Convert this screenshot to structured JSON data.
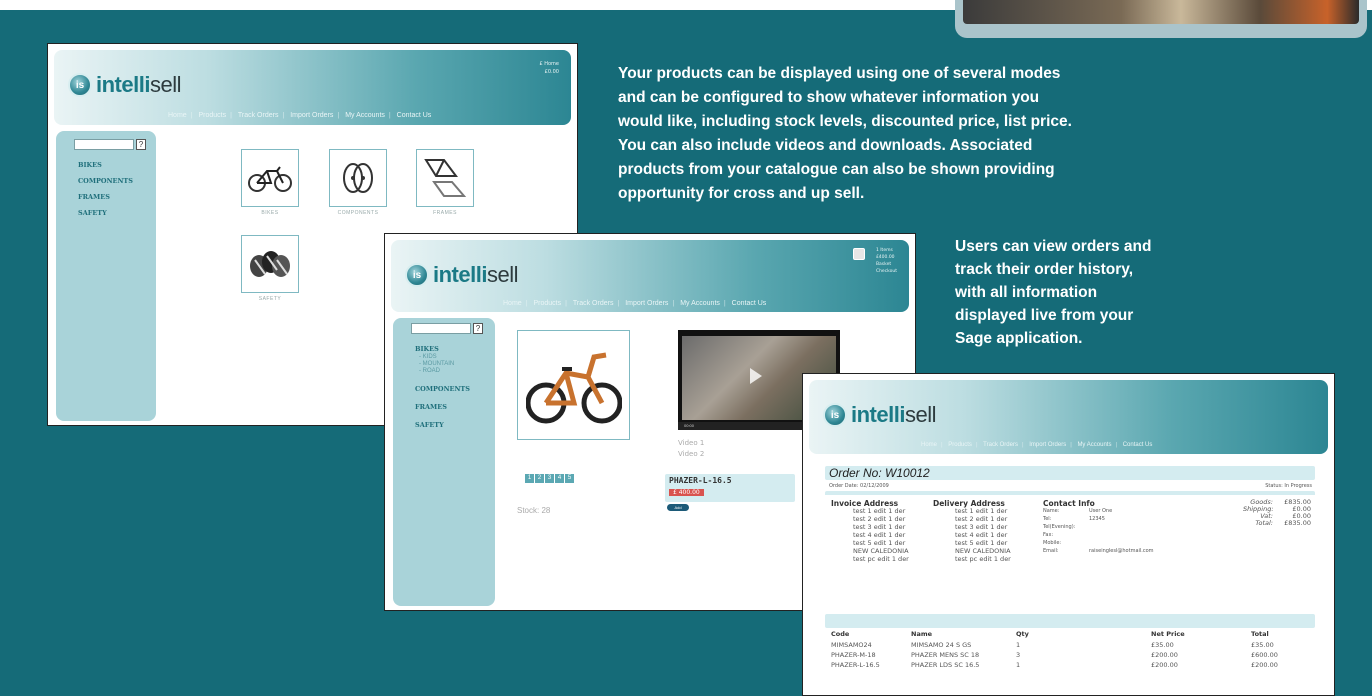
{
  "colors": {
    "background": "#156b78",
    "accent": "#1b7a86",
    "sidebar": "#a9d3d9",
    "price": "#d9534f"
  },
  "brand": {
    "logo_mark": "is",
    "logo_bold": "intelli",
    "logo_thin": "sell"
  },
  "nav": [
    "Home",
    "Products",
    "Track Orders",
    "Import Orders",
    "My Accounts",
    "Contact Us"
  ],
  "descriptions": {
    "products_text": "Your products can be displayed using one of several modes and can be configured to show whatever information you would like, including stock levels, discounted price, list price. You can also include videos and downloads. Associated products from your catalogue can also be shown providing opportunity for cross and up sell.",
    "orders_text": "Users can view orders and track their order history, with all information displayed live from your Sage application."
  },
  "shot1": {
    "header_right": [
      "£ Home",
      "£0.00"
    ],
    "search_button": "?",
    "sidebar": [
      "BIKES",
      "COMPONENTS",
      "FRAMES",
      "SAFETY"
    ],
    "categories": [
      {
        "label": "BIKES",
        "icon": "bike-icon"
      },
      {
        "label": "COMPONENTS",
        "icon": "wheels-icon"
      },
      {
        "label": "FRAMES",
        "icon": "frame-icon"
      },
      {
        "label": "SAFETY",
        "icon": "helmet-icon"
      }
    ]
  },
  "shot2": {
    "basket": [
      "1 Items",
      "£400.00",
      "Basket",
      "Checkout"
    ],
    "search_button": "?",
    "sidebar": [
      "BIKES",
      "COMPONENTS",
      "FRAMES",
      "SAFETY"
    ],
    "bikes_sub": [
      "- KIDS",
      "- MOUNTAIN",
      "- ROAD"
    ],
    "video_links": [
      "Video 1",
      "Video 2"
    ],
    "video_time": "00:00",
    "pager": [
      "1",
      "2",
      "3",
      "4",
      "5"
    ],
    "product_code": "PHAZER-L-16.5",
    "product_price": "£ 400.00",
    "add_label": "Add",
    "stock": "Stock: 28"
  },
  "shot3": {
    "order_title": "Order No:  W10012",
    "order_date": "Order Date:  02/12/2009",
    "status": "Status:  In Progress",
    "invoice_title": "Invoice Address",
    "delivery_title": "Delivery Address",
    "contact_title": "Contact Info",
    "invoice_lines": [
      "test 1 edit 1 der",
      "test 2 edit 1 der",
      "test 3 edit 1 der",
      "test 4 edit 1 der",
      "test 5 edit 1 der",
      "NEW CALEDONIA",
      "test pc edit 1 der"
    ],
    "delivery_lines": [
      "test 1 edit 1 der",
      "test 2 edit 1 der",
      "test 3 edit 1 der",
      "test 4 edit 1 der",
      "test 5 edit 1 der",
      "NEW CALEDONIA",
      "test pc edit 1 der"
    ],
    "contact_labels": [
      "Name:",
      "Tel:",
      "Tel(Evening):",
      "Fax:",
      "Mobile:",
      "Email:"
    ],
    "contact_values": [
      "User One",
      "12345",
      "",
      "",
      "",
      "raiseinglesl@hotmail.com"
    ],
    "totals_labels": [
      "Goods:",
      "Shipping:",
      "Vat:",
      "Total:"
    ],
    "totals_values": [
      "£835.00",
      "£0.00",
      "£0.00",
      "£835.00"
    ],
    "columns": [
      "Code",
      "Name",
      "Qty",
      "Net Price",
      "Total"
    ],
    "rows": [
      [
        "MIMSAMO24",
        "MIMSAMO 24 S GS",
        "1",
        "£35.00",
        "£35.00"
      ],
      [
        "PHAZER-M-18",
        "PHAZER MENS SC 18",
        "3",
        "£200.00",
        "£600.00"
      ],
      [
        "PHAZER-L-16.5",
        "PHAZER LDS SC 16.5",
        "1",
        "£200.00",
        "£200.00"
      ]
    ]
  }
}
